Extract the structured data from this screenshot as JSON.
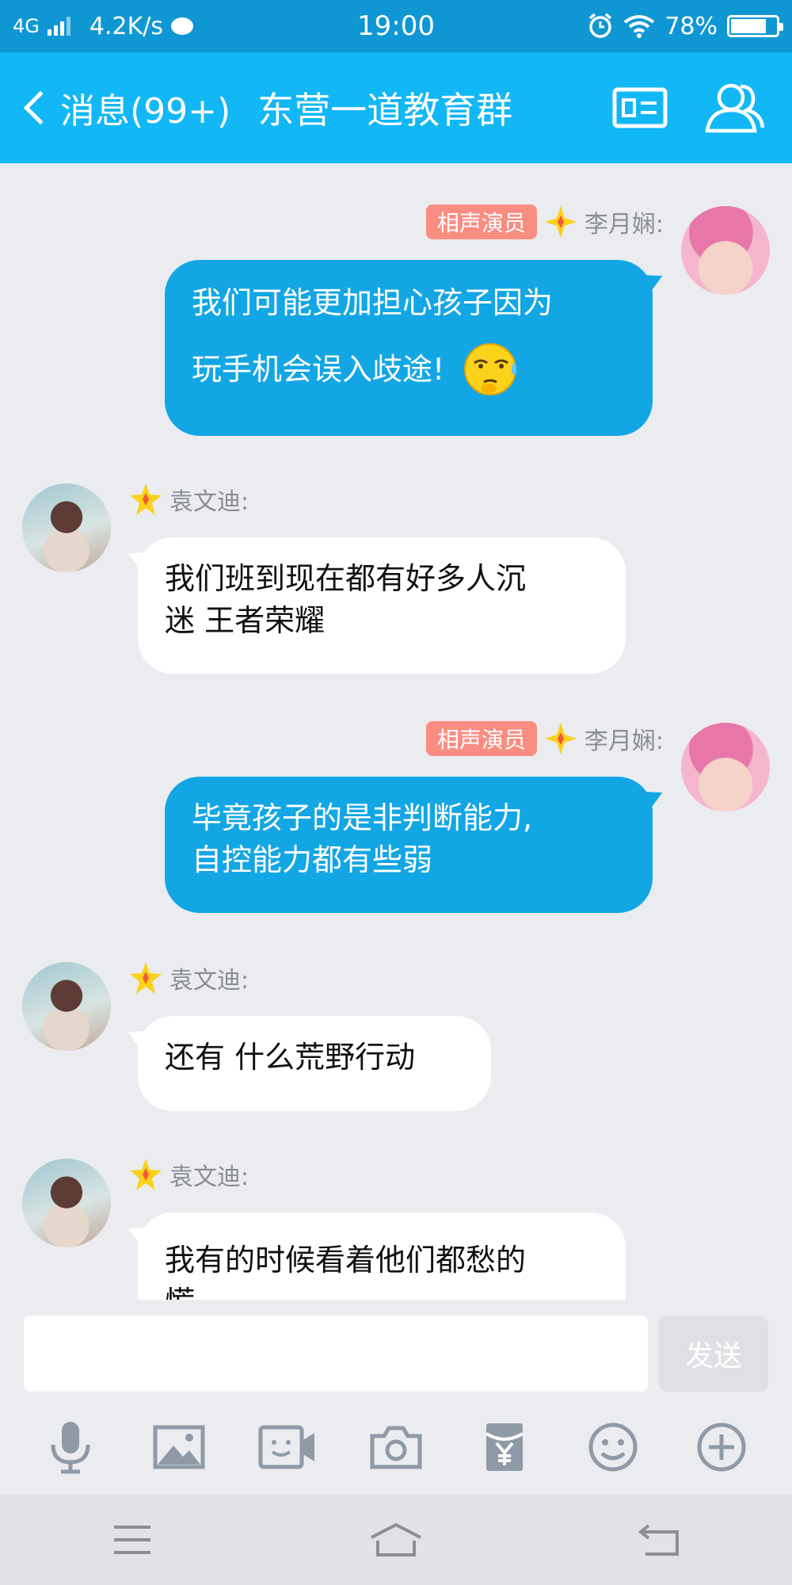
{
  "status_bar": {
    "network": "4G",
    "speed": "4.2K/s",
    "time": "19:00",
    "battery": "78%",
    "battery_level": 0.78
  },
  "header": {
    "back_label": "消息(99+)",
    "group_title": "东营一道教育群"
  },
  "messages": [
    {
      "direction": "out",
      "badge": "相声演员",
      "sender": "李月娴:",
      "text_lines": [
        "我们可能更加担心孩子因为",
        "玩手机会误入歧途!"
      ],
      "has_emoji": true
    },
    {
      "direction": "in",
      "sender": "袁文迪:",
      "text_lines": [
        "我们班到现在都有好多人沉",
        "迷  王者荣耀"
      ]
    },
    {
      "direction": "out",
      "badge": "相声演员",
      "sender": "李月娴:",
      "text_lines": [
        "毕竟孩子的是非判断能力,",
        "自控能力都有些弱"
      ]
    },
    {
      "direction": "in",
      "sender": "袁文迪:",
      "text_lines": [
        "还有  什么荒野行动"
      ]
    },
    {
      "direction": "in",
      "sender": "袁文迪:",
      "text_lines": [
        "我有的时候看着他们都愁的",
        "慌"
      ]
    }
  ],
  "input": {
    "value": "",
    "send_label": "发送"
  },
  "colors": {
    "header": "#12b7f5",
    "outgoing_bubble": "#13a6e4",
    "badge": "#f98d82"
  },
  "icons": {
    "toolbar": [
      "microphone-icon",
      "image-icon",
      "video-call-icon",
      "camera-icon",
      "red-packet-icon",
      "emoji-icon",
      "plus-icon"
    ],
    "nav": [
      "menu-icon",
      "home-icon",
      "back-icon"
    ]
  }
}
